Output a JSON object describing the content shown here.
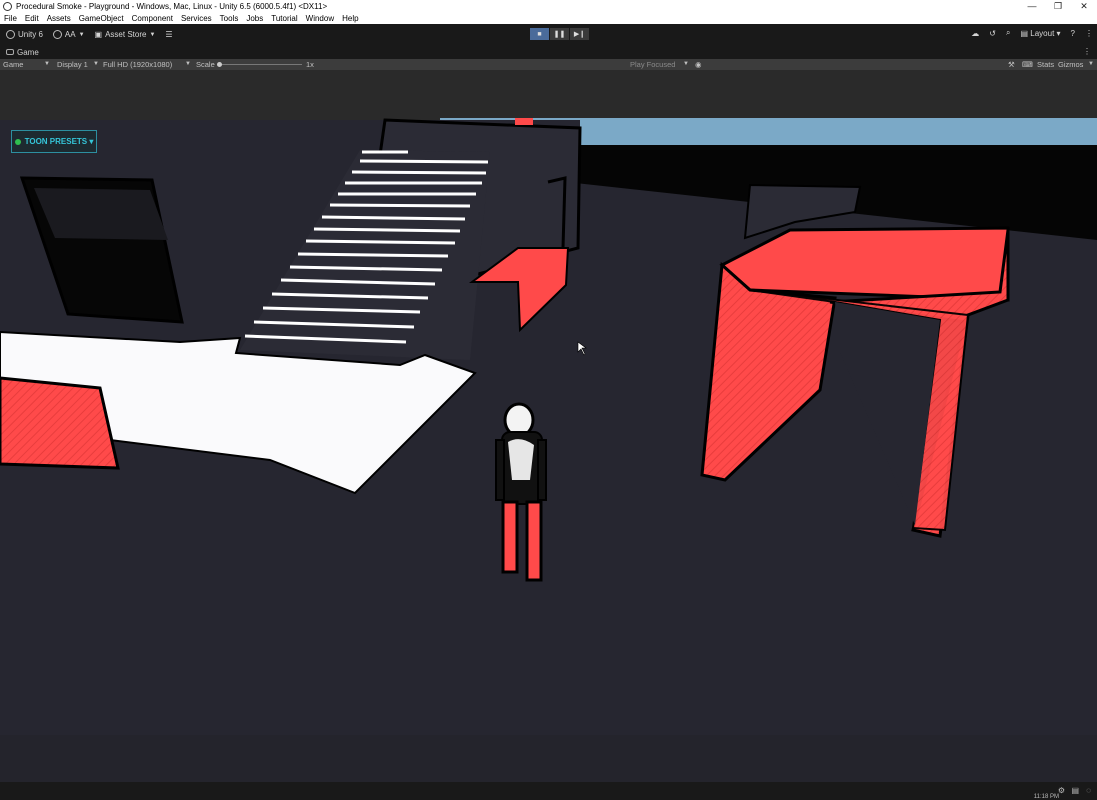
{
  "window": {
    "title": "Procedural Smoke - Playground - Windows, Mac, Linux - Unity 6.5 (6000.5.4f1) <DX11>",
    "controls": [
      "—",
      "❐",
      "✕"
    ]
  },
  "menu": [
    "File",
    "Edit",
    "Assets",
    "GameObject",
    "Component",
    "Services",
    "Tools",
    "Jobs",
    "Tutorial",
    "Window",
    "Help"
  ],
  "toolbar": {
    "unity_label": "Unity 6",
    "account_label": "AA",
    "asset_store_label": "Asset Store",
    "layout_label": "Layout"
  },
  "tabs": {
    "game_tab": "Game"
  },
  "game_toolbar": {
    "view_select": "Game",
    "display_select": "Display 1",
    "resolution_select": "Full HD (1920x1080)",
    "scale_label": "Scale",
    "scale_value": "1x",
    "play_mode_select": "Play Focused",
    "stats_label": "Stats",
    "gizmos_label": "Gizmos"
  },
  "overlay": {
    "toon_presets_label": "TOON PRESETS ▾"
  },
  "status": {
    "clock": "11:18 PM"
  },
  "colors": {
    "accent_red": "#ff4a4a",
    "ground": "#262630",
    "sky": "#7ba9c7"
  }
}
